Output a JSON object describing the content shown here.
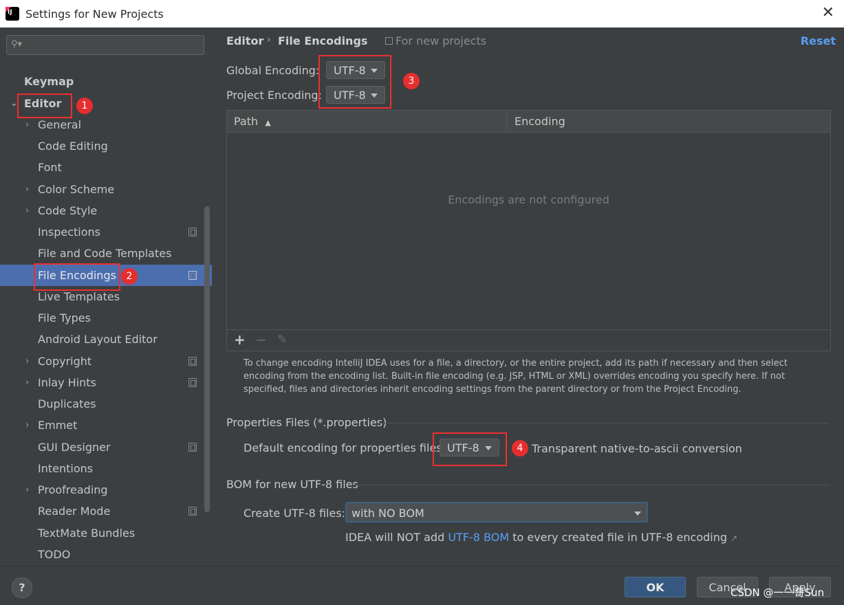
{
  "window": {
    "title": "Settings for New Projects",
    "close_glyph": "✕"
  },
  "search": {
    "placeholder": "",
    "icon": "search-icon"
  },
  "sidebar": {
    "items": [
      {
        "label": "Keymap"
      },
      {
        "label": "Editor"
      },
      {
        "label": "General"
      },
      {
        "label": "Code Editing"
      },
      {
        "label": "Font"
      },
      {
        "label": "Color Scheme"
      },
      {
        "label": "Code Style"
      },
      {
        "label": "Inspections"
      },
      {
        "label": "File and Code Templates"
      },
      {
        "label": "File Encodings"
      },
      {
        "label": "Live Templates"
      },
      {
        "label": "File Types"
      },
      {
        "label": "Android Layout Editor"
      },
      {
        "label": "Copyright"
      },
      {
        "label": "Inlay Hints"
      },
      {
        "label": "Duplicates"
      },
      {
        "label": "Emmet"
      },
      {
        "label": "GUI Designer"
      },
      {
        "label": "Intentions"
      },
      {
        "label": "Proofreading"
      },
      {
        "label": "Reader Mode"
      },
      {
        "label": "TextMate Bundles"
      },
      {
        "label": "TODO"
      }
    ],
    "selected": "File Encodings"
  },
  "annotations": {
    "b1": "1",
    "b2": "2",
    "b3": "3",
    "b4": "4"
  },
  "header": {
    "crumb1": "Editor",
    "crumb_sep": "›",
    "crumb2": "File Encodings",
    "for_new": "For new projects",
    "reset": "Reset"
  },
  "encoding": {
    "global_label": "Global Encoding:",
    "global_value": "UTF-8",
    "project_label": "Project Encoding:",
    "project_value": "UTF-8"
  },
  "table": {
    "col_path": "Path",
    "sort_glyph": "▲",
    "col_encoding": "Encoding",
    "empty_text": "Encodings are not configured",
    "add_glyph": "+",
    "remove_glyph": "−",
    "edit_glyph": "✎"
  },
  "help_text": "To change encoding IntelliJ IDEA uses for a file, a directory, or the entire project, add its path if necessary and then select encoding from the encoding list. Built-in file encoding (e.g. JSP, HTML or XML) overrides encoding you specify here. If not specified, files and directories inherit encoding settings from the parent directory or from the Project Encoding.",
  "properties": {
    "section_title": "Properties Files (*.properties)",
    "default_label": "Default encoding for properties files:",
    "default_value": "UTF-8",
    "native_label": "Transparent native-to-ascii conversion"
  },
  "bom": {
    "section_title": "BOM for new UTF-8 files",
    "create_label": "Create UTF-8 files:",
    "create_value": "with NO BOM",
    "note_pre": "IDEA will NOT add ",
    "note_link": "UTF-8 BOM",
    "note_post": " to every created file in UTF-8 encoding",
    "ext_glyph": "↗"
  },
  "footer": {
    "help": "?",
    "ok": "OK",
    "cancel": "Cancel",
    "apply": "Apply",
    "watermark": "CSDN @一一哥Sun"
  },
  "colors": {
    "accent": "#4b6eaf",
    "link": "#589df6",
    "annotation": "#e62e2e",
    "ok_button": "#365880"
  }
}
